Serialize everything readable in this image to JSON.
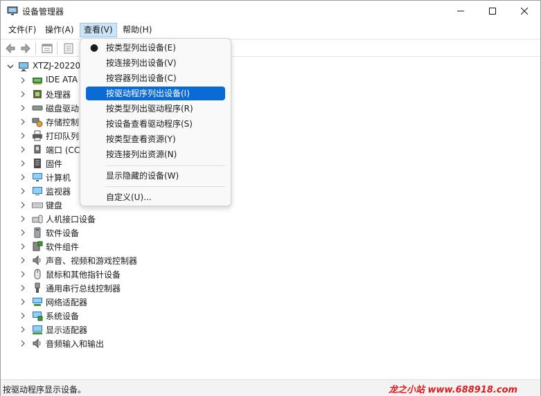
{
  "window": {
    "title": "设备管理器"
  },
  "menubar": [
    {
      "label": "文件(F)"
    },
    {
      "label": "操作(A)"
    },
    {
      "label": "查看(V)"
    },
    {
      "label": "帮助(H)"
    }
  ],
  "tree": {
    "root": "XTZJ-20220",
    "items": [
      {
        "label": "IDE ATA",
        "icon": "ide-ata-icon"
      },
      {
        "label": "处理器",
        "icon": "processor-icon"
      },
      {
        "label": "磁盘驱动",
        "icon": "disk-drive-icon"
      },
      {
        "label": "存储控制",
        "icon": "storage-controller-icon"
      },
      {
        "label": "打印队列",
        "icon": "print-queue-icon"
      },
      {
        "label": "端口 (CC",
        "icon": "port-icon"
      },
      {
        "label": "固件",
        "icon": "firmware-icon"
      },
      {
        "label": "计算机",
        "icon": "computer-icon"
      },
      {
        "label": "监视器",
        "icon": "monitor-icon"
      },
      {
        "label": "键盘",
        "icon": "keyboard-icon"
      },
      {
        "label": "人机接口设备",
        "icon": "hid-icon"
      },
      {
        "label": "软件设备",
        "icon": "software-device-icon"
      },
      {
        "label": "软件组件",
        "icon": "software-component-icon"
      },
      {
        "label": "声音、视频和游戏控制器",
        "icon": "speaker-icon"
      },
      {
        "label": "鼠标和其他指针设备",
        "icon": "mouse-icon"
      },
      {
        "label": "通用串行总线控制器",
        "icon": "usb-icon"
      },
      {
        "label": "网络适配器",
        "icon": "network-adapter-icon"
      },
      {
        "label": "系统设备",
        "icon": "system-device-icon"
      },
      {
        "label": "显示适配器",
        "icon": "display-adapter-icon"
      },
      {
        "label": "音频输入和输出",
        "icon": "audio-io-icon"
      }
    ]
  },
  "view_menu": {
    "items": [
      {
        "label": "按类型列出设备(E)",
        "checked": true
      },
      {
        "label": "按连接列出设备(V)"
      },
      {
        "label": "按容器列出设备(C)"
      },
      {
        "label": "按驱动程序列出设备(I)",
        "highlighted": true
      },
      {
        "label": "按类型列出驱动程序(R)"
      },
      {
        "label": "按设备查看驱动程序(S)"
      },
      {
        "label": "按类型查看资源(Y)"
      },
      {
        "label": "按连接列出资源(N)"
      },
      {
        "label": "显示隐藏的设备(W)"
      },
      {
        "label": "自定义(U)..."
      }
    ]
  },
  "status": {
    "text": "按驱动程序显示设备。"
  },
  "watermark": {
    "text": "龙之小站 www.688918.com"
  },
  "colors": {
    "highlight": "#0b6bd6",
    "menu_active": "#cce4f7",
    "watermark": "#e11b1b"
  }
}
